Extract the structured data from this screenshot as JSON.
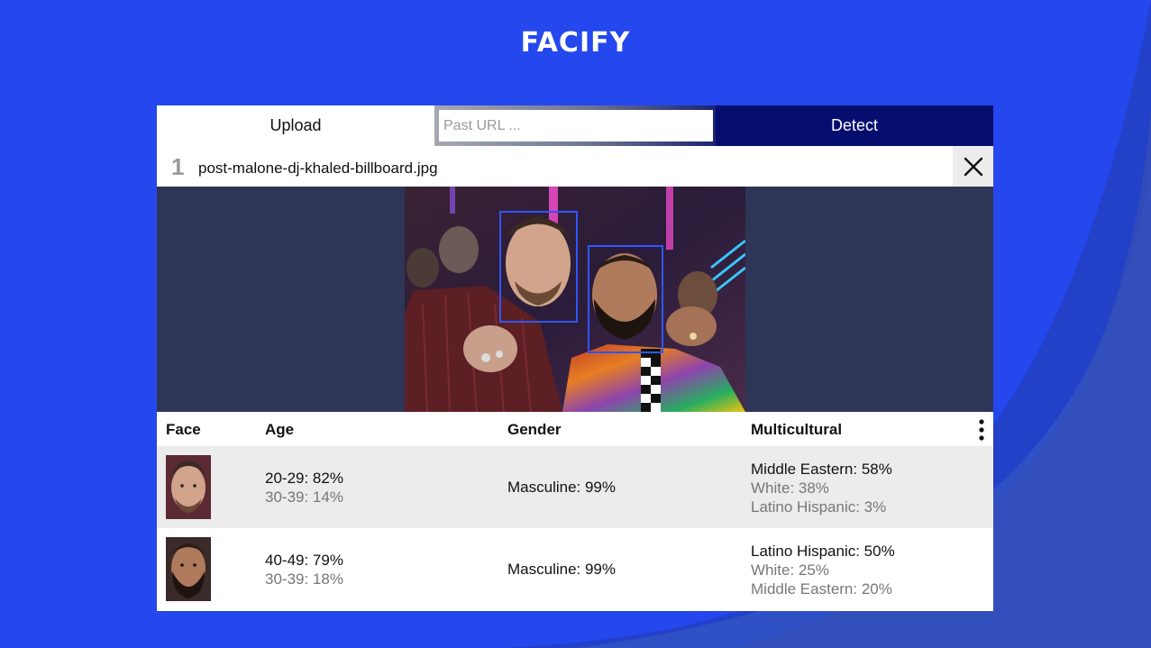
{
  "app": {
    "logo": "FACIFY"
  },
  "colors": {
    "background": "#2447ee",
    "detect_button": "#050d6f",
    "face_box": "#2f56ff",
    "preview_bg": "#2d3657"
  },
  "toolbar": {
    "upload_label": "Upload",
    "url_placeholder": "Past URL ...",
    "url_value": "",
    "detect_label": "Detect"
  },
  "file": {
    "index": "1",
    "name": "post-malone-dj-khaled-billboard.jpg",
    "close_icon": "close-icon"
  },
  "table": {
    "headers": {
      "face": "Face",
      "age": "Age",
      "gender": "Gender",
      "multicultural": "Multicultural"
    },
    "menu_icon": "more-vertical-icon",
    "rows": [
      {
        "age": {
          "primary": "20-29: 82%",
          "secondary": "30-39: 14%"
        },
        "gender": "Masculine: 99%",
        "multicultural": {
          "primary": "Middle Eastern: 58%",
          "secondary": [
            "White: 38%",
            "Latino Hispanic: 3%"
          ]
        }
      },
      {
        "age": {
          "primary": "40-49: 79%",
          "secondary": "30-39: 18%"
        },
        "gender": "Masculine: 99%",
        "multicultural": {
          "primary": "Latino Hispanic: 50%",
          "secondary": [
            "White: 25%",
            "Middle Eastern: 20%"
          ]
        }
      }
    ]
  }
}
